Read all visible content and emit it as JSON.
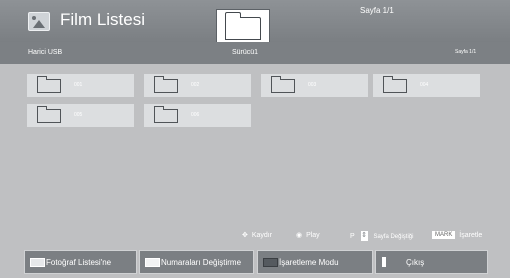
{
  "header": {
    "title": "Film Listesi",
    "page_info": "Sayfa 1/1",
    "app_icon": "photo-icon",
    "drive_icon": "folder-icon"
  },
  "subbar": {
    "device": "Harici USB",
    "drive": "Sürücü1",
    "page": "Sayfa 1/1"
  },
  "folders": [
    {
      "label": "001"
    },
    {
      "label": "002"
    },
    {
      "label": "003"
    },
    {
      "label": "004"
    },
    {
      "label": "005"
    },
    {
      "label": "006"
    }
  ],
  "hints": {
    "scroll_icon": "dpad-icon",
    "scroll": "Kaydır",
    "play_icon": "ok-circle-icon",
    "play": "Play",
    "p_key": "P",
    "page_change": "Sayfa Değiştiği",
    "mark_key": "MARK",
    "mark": "İşaretle"
  },
  "buttons": [
    {
      "label": "Fotoğraf Listesi'ne",
      "color": "#e6e8ea"
    },
    {
      "label": "Numaraları Değiştirme",
      "color": "#f2f3f4"
    },
    {
      "label": "İşaretleme Modu",
      "color": "#555a5f"
    },
    {
      "label": "Çıkış",
      "color": "#ffffff"
    }
  ]
}
